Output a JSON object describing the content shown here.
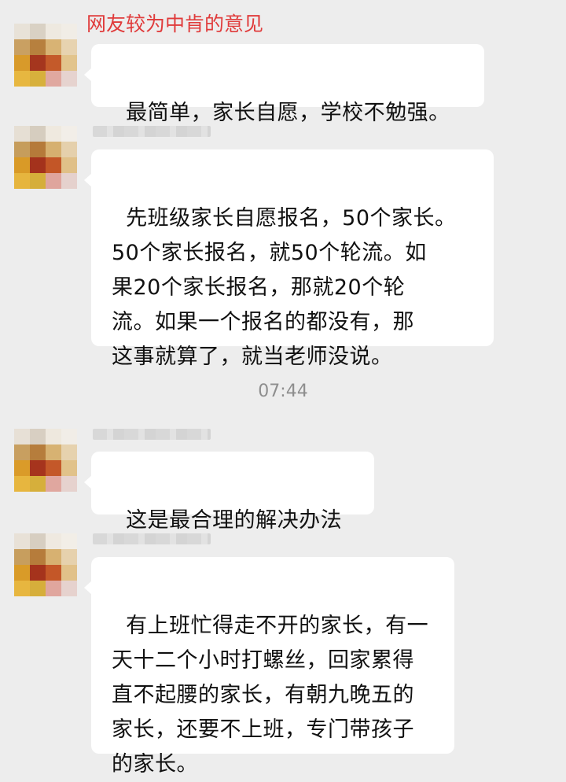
{
  "annotation": "网友较为中肯的意见",
  "timestamp": "07:44",
  "messages": [
    {
      "text": "最简单，家长自愿，学校不勉强。"
    },
    {
      "text": "先班级家长自愿报名，50个家长。\n50个家长报名，就50个轮流。如\n果20个家长报名，那就20个轮\n流。如果一个报名的都没有，那\n这事就算了，就当老师没说。"
    },
    {
      "text": "这是最合理的解决办法"
    },
    {
      "text": "有上班忙得走不开的家长，有一\n天十二个小时打螺丝，回家累得\n直不起腰的家长，有朝九晚五的\n家长，还要不上班，专门带孩子\n的家长。"
    }
  ],
  "colors": {
    "background": "#ededed",
    "bubble": "#ffffff",
    "annotation": "#e03b3b",
    "timestamp": "#8e8e8e"
  },
  "icons": [
    "avatar-pixelated"
  ]
}
